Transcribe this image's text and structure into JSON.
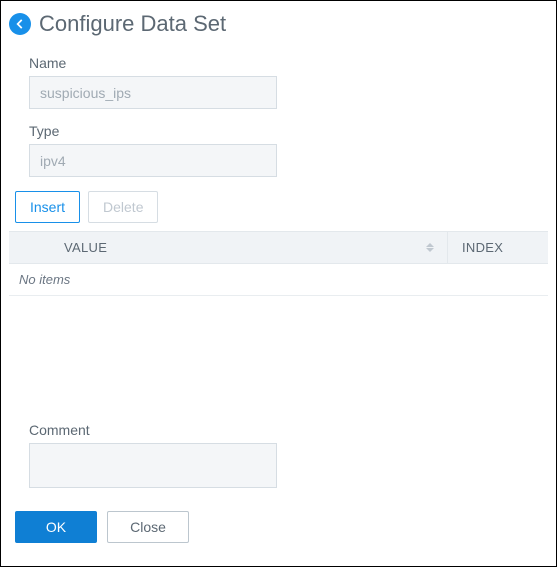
{
  "header": {
    "title": "Configure Data Set"
  },
  "form": {
    "name_label": "Name",
    "name_value": "suspicious_ips",
    "type_label": "Type",
    "type_value": "ipv4",
    "comment_label": "Comment",
    "comment_value": ""
  },
  "buttons": {
    "insert": "Insert",
    "delete": "Delete",
    "ok": "OK",
    "close": "Close"
  },
  "table": {
    "columns": {
      "value": "VALUE",
      "index": "INDEX"
    },
    "empty_text": "No items"
  }
}
